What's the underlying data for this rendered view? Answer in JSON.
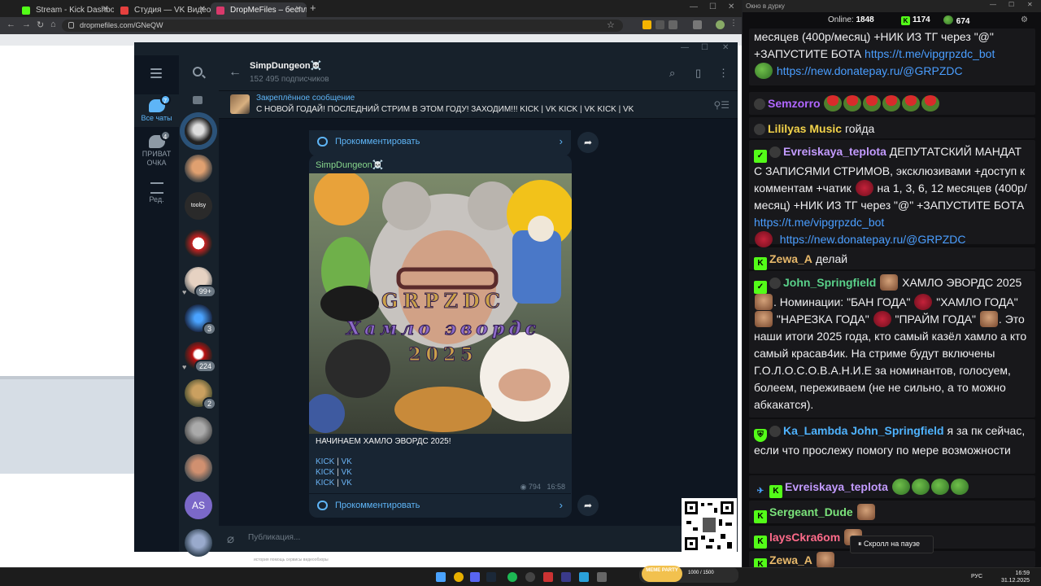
{
  "browser": {
    "tabs": [
      {
        "title": "Stream - Kick Dashboard",
        "color": "#53fc18"
      },
      {
        "title": "Студия — VK Видео Live",
        "color": "#e5403e"
      },
      {
        "title": "DropMeFiles – бесплатный фа...",
        "color": "#d9396b"
      }
    ],
    "url": "dropmefiles.com/GNeQW",
    "page_footnote": "история   помощь   сервисы   видеообзоры"
  },
  "telegram": {
    "folders": [
      {
        "label": "Все чаты",
        "badge": "7"
      },
      {
        "label": "ПРИВАТ ОЧКА",
        "badge": "4"
      },
      {
        "label": "Ред.",
        "badge": ""
      }
    ],
    "chat_badges": {
      "c6": "99+",
      "c7": "3",
      "c8": "224",
      "c9": "2"
    },
    "avatar_as": "AS",
    "channel": {
      "name": "SimpDungeon☠️",
      "subscribers": "152 495 подписчиков"
    },
    "pinned": {
      "label": "Закреплённое сообщение",
      "text": "С НОВОЙ ГОДАЙ! ПОСЛЕДНИЙ СТРИМ В ЭТОМ ГОДУ! ЗАХОДИМ!!!  KICK | VK KICK | VK KICK | VK"
    },
    "comment_label": "Прокомментировать",
    "post": {
      "author": "SimpDungeon☠️",
      "image_text_1": "GRPZDC",
      "image_text_2": "Хамло эвордс",
      "image_text_3": "2025",
      "text": "НАЧИНАЕМ ХАМЛО ЭВОРДС 2025!",
      "links": [
        {
          "a": "KICK",
          "sep": " | ",
          "b": "VK"
        },
        {
          "a": "KICK",
          "sep": " | ",
          "b": "VK"
        },
        {
          "a": "KICK",
          "sep": " | ",
          "b": "VK"
        }
      ],
      "views": "794",
      "time": "16:58"
    },
    "composer_placeholder": "Публикация..."
  },
  "chat": {
    "window_title": "Окно в дурку",
    "online_label": "Online:",
    "online_value": "1848",
    "kick_count": "1174",
    "vk_count": "674",
    "messages": {
      "m0_a": "месяцев (400р/месяц) +НИК ИЗ ТГ через \"@\" +ЗАПУСТИТЕ БОТА ",
      "m0_link1": "https://t.me/vipgrpzdc_bot",
      "m0_link2": "https://new.donatepay.ru/@GRPZDC",
      "m1_user": "Semzorro",
      "m2_user": "Lililyas Music",
      "m2_text": "гойда",
      "m3_user": "Evreiskaya_teplota",
      "m3_text_a": "ДЕПУТАТСКИЙ МАНДАТ С ЗАПИСЯМИ СТРИМОВ, эксклюзивами +доступ к комментам +чатик ",
      "m3_text_b": " на 1, 3, 6, 12 месяцев (400р/месяц) +НИК ИЗ ТГ через \"@\" +ЗАПУСТИТЕ БОТА ",
      "m3_link1": "https://t.me/vipgrpzdc_bot",
      "m3_link2": "https://new.donatepay.ru/@GRPZDC",
      "m4_user": "Zewa_A",
      "m4_text": "делай",
      "m5_user": "John_Springfield",
      "m5_t1": "ХАМЛО ЭВОРДС 2025",
      "m5_t2": ". Номинации: \"БАН ГОДА\"",
      "m5_t3": "\"ХАМЛО ГОДА\"",
      "m5_t4": "\"НАРЕЗКА ГОДА\"",
      "m5_t5": "\"ПРАЙМ ГОДА\"",
      "m5_t6": ". Это наши итоги 2025 года, кто самый казёл хамло а кто самый красав4ик. На стриме будут включены Г.О.Л.О.С.О.В.А.Н.И.Е за номинантов, голосуем, болеем, переживаем (не не сильно, а то можно абкакатся).",
      "m6_user": "Ka_Lambda",
      "m6_mention": "John_Springfield",
      "m6_text": "я за пк сейчас, если что прослежу помогу по мере возможности",
      "m7_user": "Evreiskaya_teplota",
      "m8_user": "Sergeant_Dude",
      "m9_user": "laysCkra6om",
      "m10_user": "Zewa_A"
    },
    "pause_label": "⏸ Скролл на паузе"
  },
  "taskbar": {
    "lang": "РУС",
    "time": "16:59",
    "date": "31.12.2025",
    "meme_label": "MEME PARTY",
    "meme_counter": "1000 / 1500"
  },
  "colors": {
    "kick": "#53fc18",
    "tg_accent": "#5eb5f7",
    "chat_bg": "#18181b"
  }
}
